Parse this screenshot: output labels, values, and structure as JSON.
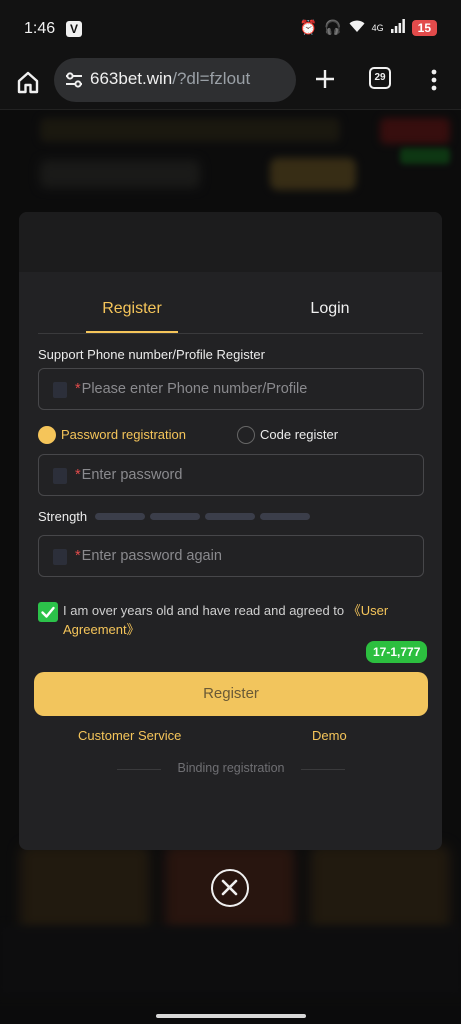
{
  "status_bar": {
    "time": "1:46",
    "app_badge": "V",
    "network": "4G",
    "battery": "15"
  },
  "browser": {
    "url_host": "663bet.win",
    "url_path": "/?dl=fzlout",
    "tab_count": "29"
  },
  "modal": {
    "tabs": [
      {
        "label": "Register",
        "active": true
      },
      {
        "label": "Login",
        "active": false
      }
    ],
    "phone_label": "Support Phone number/Profile Register",
    "phone_placeholder": "Please enter Phone number/Profile",
    "radio_options": [
      {
        "label": "Password registration",
        "selected": true
      },
      {
        "label": "Code register",
        "selected": false
      }
    ],
    "password_placeholder": "Enter password",
    "strength_label": "Strength",
    "password_again_placeholder": "Enter password again",
    "required_mark": "*",
    "agreement_text": "I am over years old and have read and agreed to",
    "agreement_link": "《User Agreement》",
    "agreement_checked": true,
    "badge": "17-1,777",
    "register_button": "Register",
    "customer_service": "Customer Service",
    "demo": "Demo",
    "binding_registration": "Binding registration"
  },
  "colors": {
    "accent": "#f5c55a",
    "button": "#f2c55d",
    "success": "#2cc24a",
    "required": "#e24b4b"
  }
}
